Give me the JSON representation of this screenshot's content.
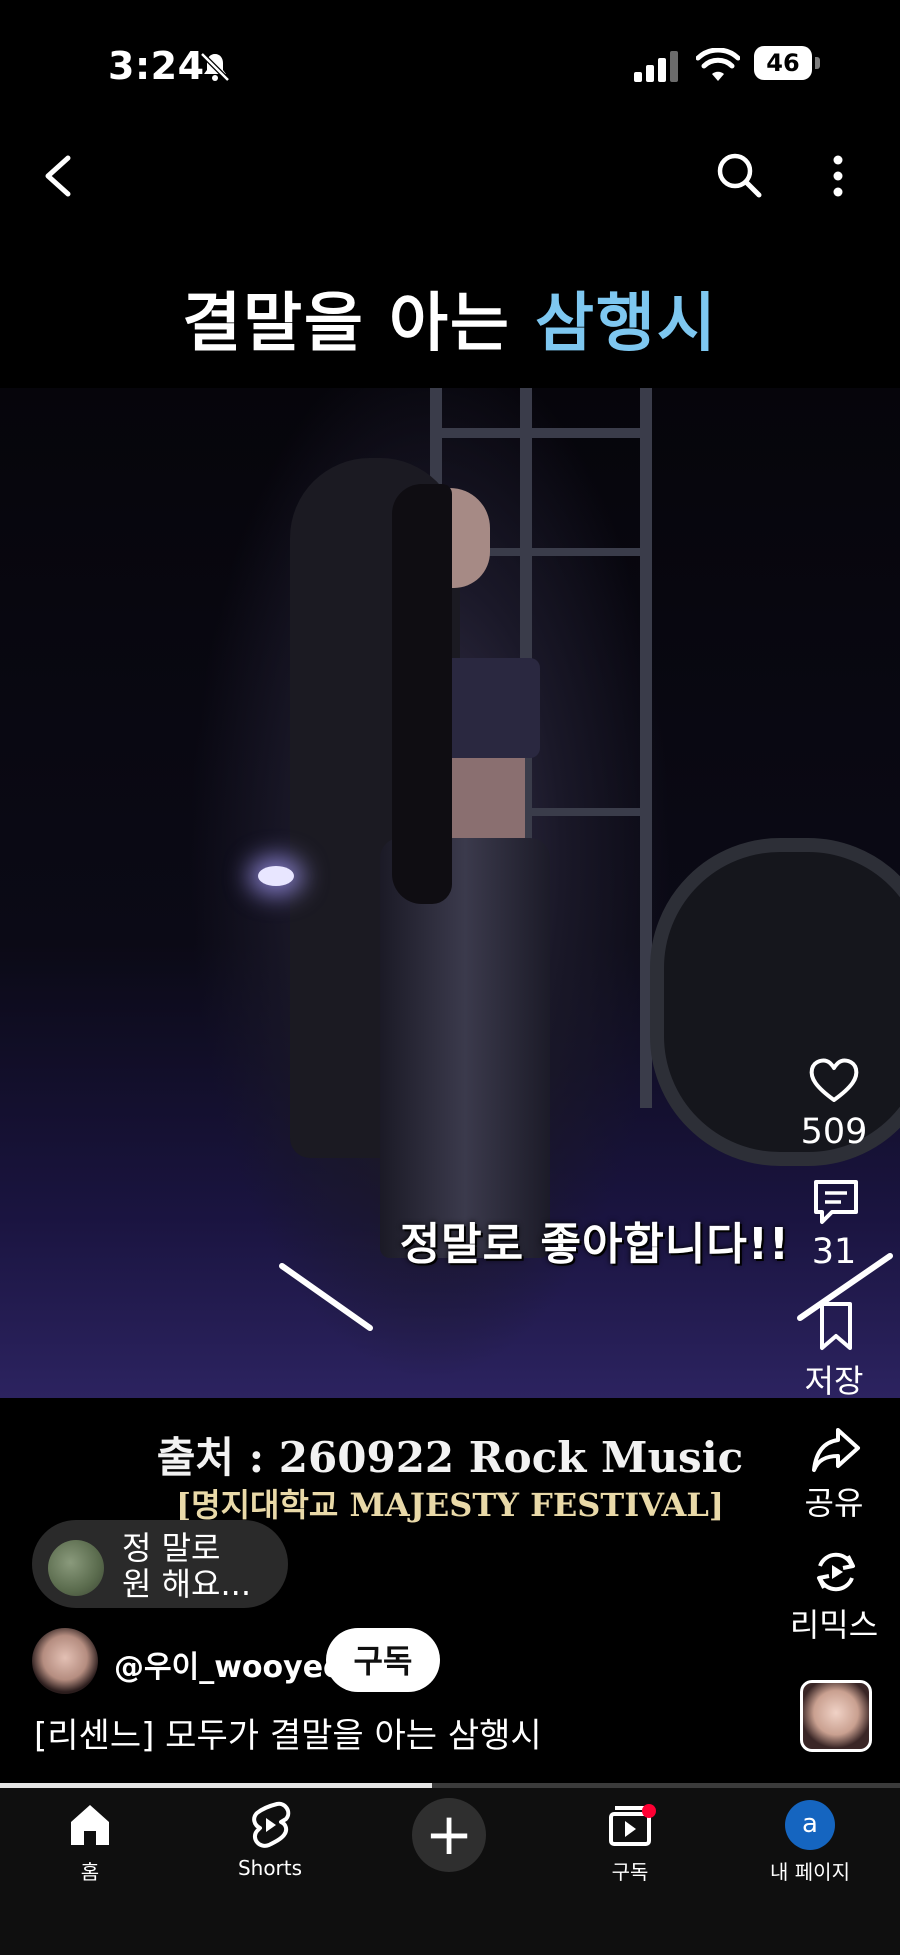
{
  "status_bar": {
    "time": "3:24",
    "battery": "46"
  },
  "header": {
    "back_icon": "chevron-left-icon",
    "search_icon": "search-icon",
    "more_icon": "more-vertical-icon"
  },
  "video": {
    "title_main": "결말을 아는 ",
    "title_accent": "삼행시",
    "subtitle": "정말로 좋아합니다!!",
    "source_line1": "출처 : 260922 Rock Music",
    "source_line2": "[명지대학교 MAJESTY FESTIVAL]",
    "progress": 0.48
  },
  "actions": {
    "like_count": "509",
    "comment_count": "31",
    "save_label": "저장",
    "share_label": "공유",
    "remix_label": "리믹스"
  },
  "comment_preview": {
    "line1": "정 말로",
    "line2": "원 해요..."
  },
  "channel": {
    "handle": "@우이_wooyee",
    "subscribe_label": "구독"
  },
  "short_title": "[리센느] 모두가 결말을 아는 삼행시",
  "bottom_nav": {
    "home_label": "홈",
    "shorts_label": "Shorts",
    "subscriptions_label": "구독",
    "me_label": "내 페이지",
    "me_initial": "a"
  },
  "colors": {
    "accent_title": "#7ec7f0",
    "subscribe_bg": "#ffffff",
    "notification_dot": "#ff0033",
    "avatar_blue": "#1565c0"
  }
}
